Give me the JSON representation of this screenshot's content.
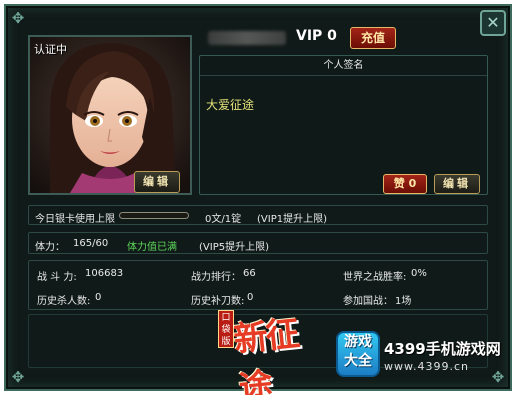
{
  "profile": {
    "cert_label": "认证中",
    "edit_label": "编辑",
    "vip_label": "VIP 0",
    "recharge_label": "充值"
  },
  "signature": {
    "header": "个人签名",
    "text": "大爱征途",
    "like_label": "赞 0",
    "edit_label": "编辑"
  },
  "silver": {
    "label": "今日银卡使用上限",
    "progress": 0,
    "value": "0文/1锭",
    "note": "(VIP1提升上限)"
  },
  "stamina": {
    "label": "体力：",
    "value": "165/60",
    "status": "体力值已满",
    "note": "(VIP5提升上限)"
  },
  "stats": {
    "combat_label": "战 斗 力:",
    "combat_value": "106683",
    "combat_rank_label": "战力排行：",
    "combat_rank_value": "66",
    "world_war_label": "世界之战胜率:",
    "world_war_value": "0%",
    "kills_label": "历史杀人数:",
    "kills_value": "0",
    "knives_label": "历史补刀数:",
    "knives_value": "0",
    "national_war_label": "参加国战：",
    "national_war_value": "1场"
  },
  "logo": {
    "small": "口袋版",
    "big": "新征途"
  },
  "watermark": {
    "badge_line1": "游戏",
    "badge_line2": "大全",
    "site": "4399手机游戏网",
    "url": "www.4399.cn"
  },
  "icons": {
    "close": "close-x-icon",
    "corner": "corner-ornament-icon"
  },
  "colors": {
    "frame": "#3f6a5e",
    "accent_red": "#a32418",
    "gold": "#e6b765",
    "highlight_yellow": "#e4e27a",
    "status_green": "#5ed65a"
  }
}
